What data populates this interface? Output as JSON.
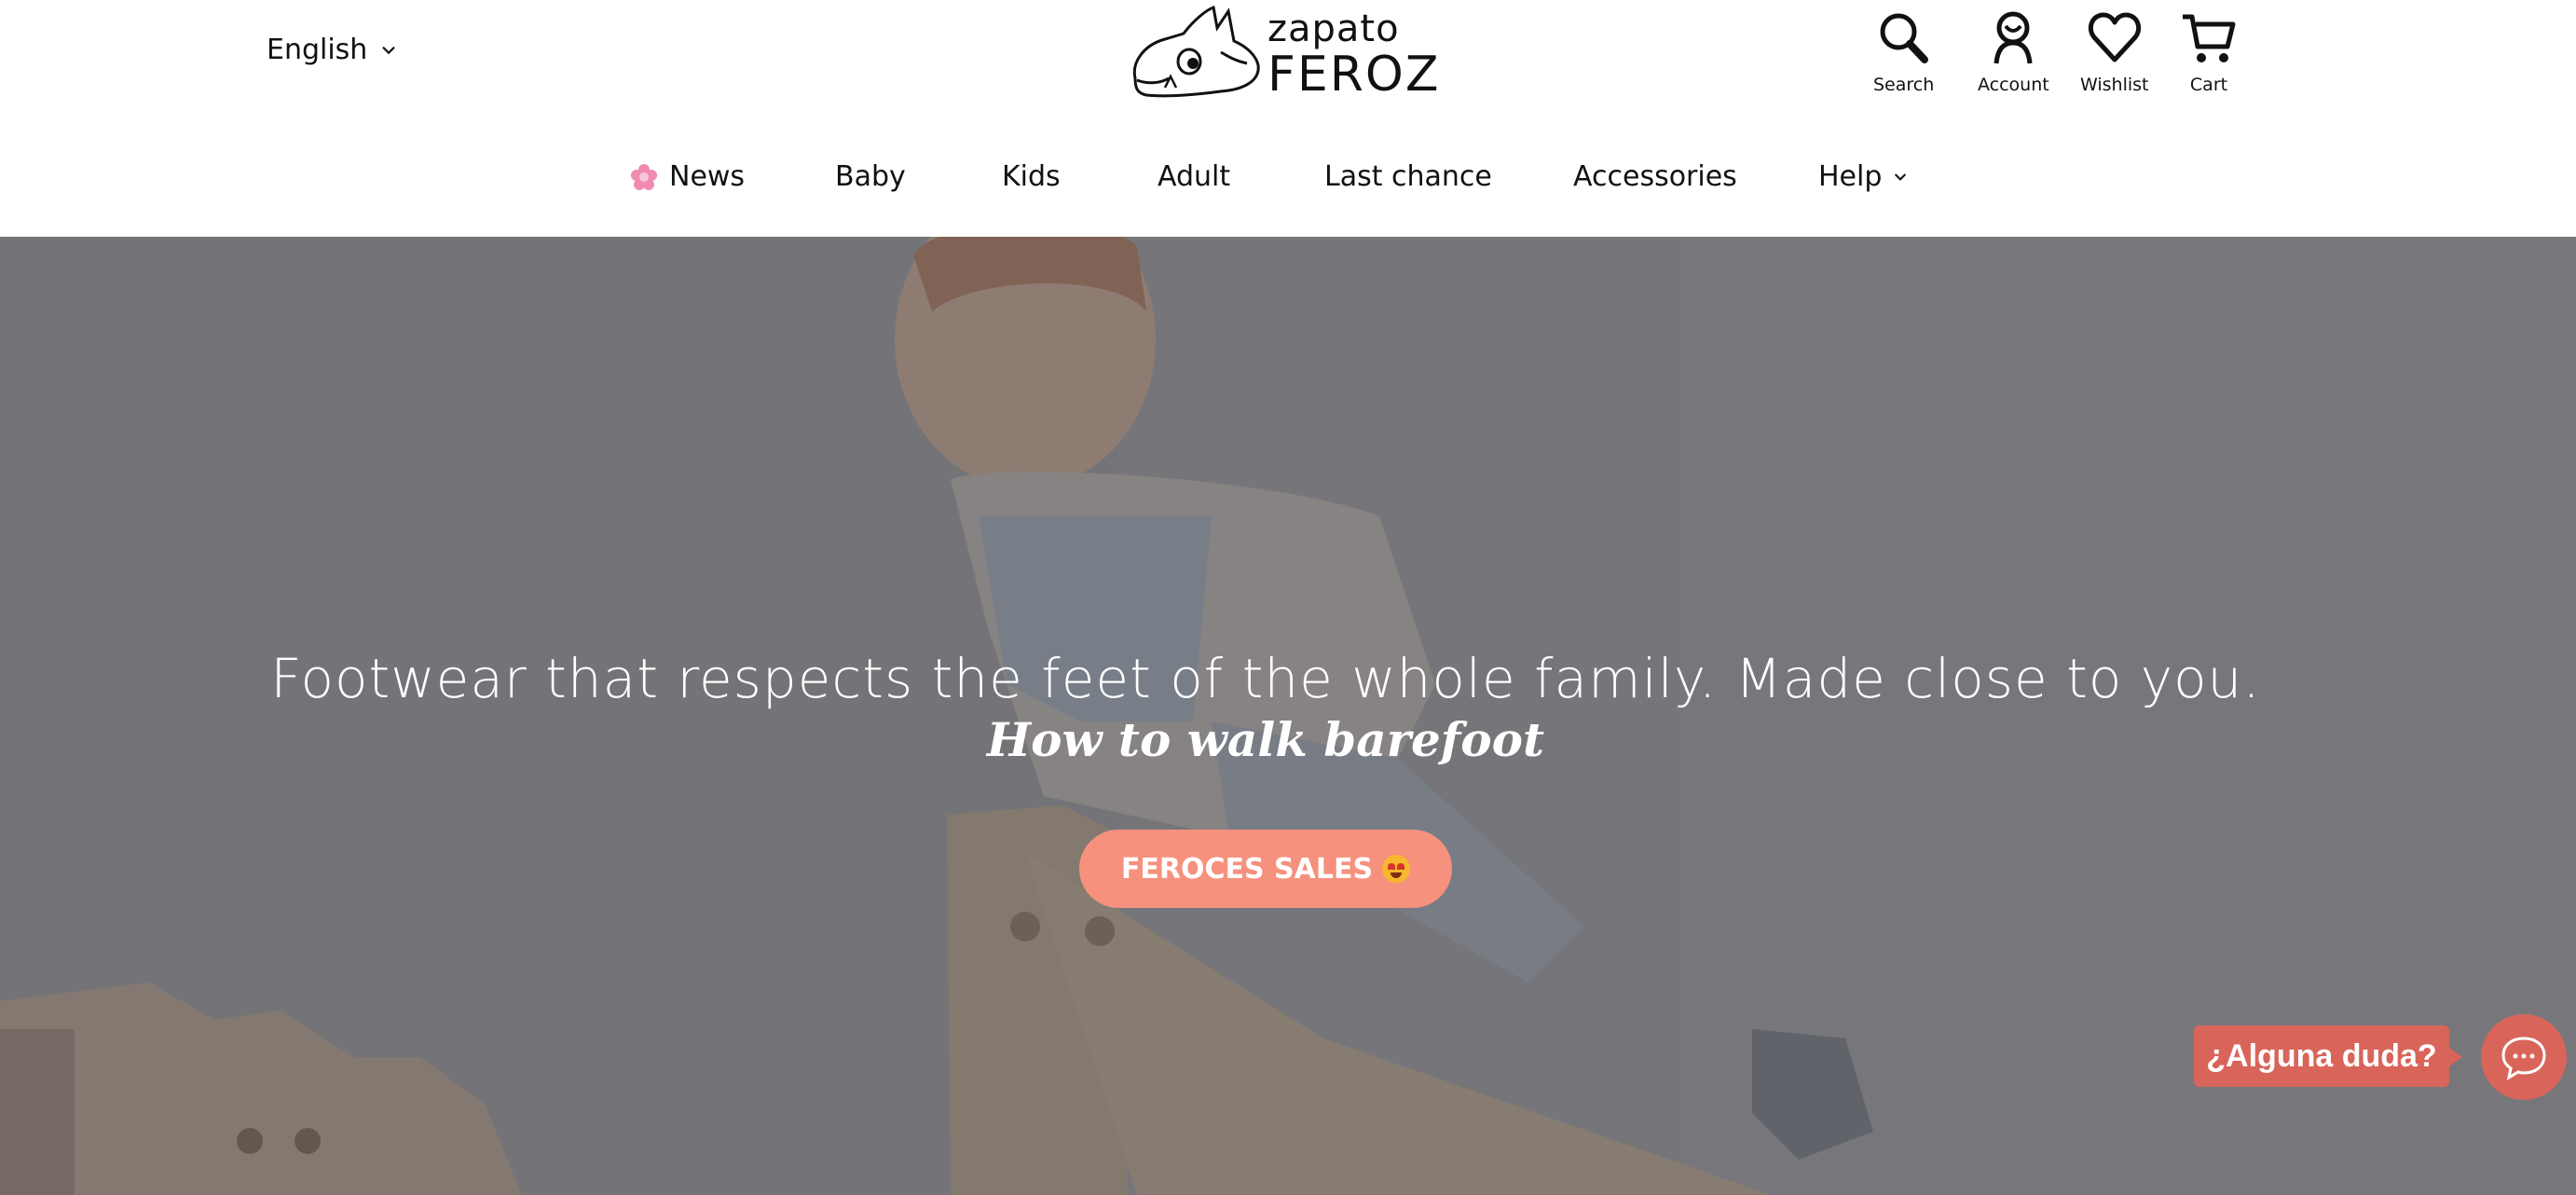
{
  "header": {
    "language": "English",
    "logo_line1": "zapato",
    "logo_line2": "FEROZ",
    "icons": [
      {
        "name": "search-icon",
        "label": "Search"
      },
      {
        "name": "account-icon",
        "label": "Account"
      },
      {
        "name": "wishlist-icon",
        "label": "Wishlist"
      },
      {
        "name": "cart-icon",
        "label": "Cart"
      }
    ]
  },
  "nav": {
    "items": [
      {
        "label": "News",
        "icon": "flower-icon"
      },
      {
        "label": "Baby"
      },
      {
        "label": "Kids"
      },
      {
        "label": "Adult"
      },
      {
        "label": "Last chance"
      },
      {
        "label": "Accessories"
      },
      {
        "label": "Help",
        "icon": "chevron-down-icon"
      }
    ]
  },
  "hero": {
    "title": "Footwear that respects the feet of the whole family. Made close to you.",
    "subtitle": "How to walk barefoot",
    "cta_label": "FEROCES SALES",
    "cta_icon": "heart-eyes-emoji",
    "overlay_color": "#6e6e72"
  },
  "chat": {
    "bubble_text": "¿Alguna duda?",
    "icon": "chat-bubble-icon",
    "color": "#d9655a"
  },
  "colors": {
    "cta": "#f6917e",
    "text": "#111111"
  }
}
